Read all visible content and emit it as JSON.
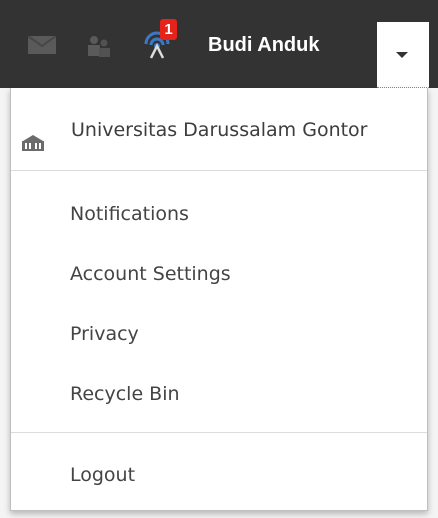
{
  "topbar": {
    "icons": [
      "mail-icon",
      "friends-icon",
      "signal-icon"
    ],
    "notification_count": "1",
    "user_name": "Budi Anduk",
    "toggle_icon": "chevron-down-icon",
    "colors": {
      "bar": "#333333",
      "badge": "#e5231b",
      "signal": "#3b79c4"
    }
  },
  "menu": {
    "organization": {
      "icon": "building-icon",
      "label": "Universitas Darussalam Gontor"
    },
    "items": [
      {
        "label": "Notifications"
      },
      {
        "label": "Account Settings"
      },
      {
        "label": "Privacy"
      },
      {
        "label": "Recycle Bin"
      }
    ],
    "logout": {
      "label": "Logout"
    }
  }
}
